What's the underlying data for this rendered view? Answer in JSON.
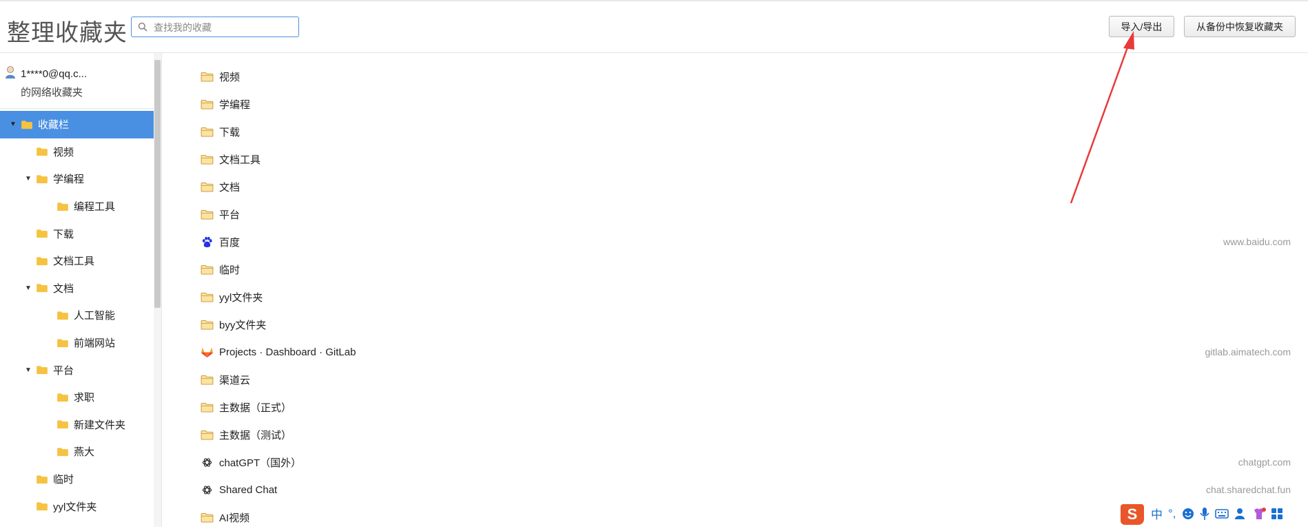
{
  "header": {
    "title": "整理收藏夹",
    "search_placeholder": "查找我的收藏",
    "import_export_label": "导入/导出",
    "restore_label": "从备份中恢复收藏夹"
  },
  "account": {
    "email": "1****0@qq.c...",
    "subtitle": "的网络收藏夹"
  },
  "tree": [
    {
      "label": "收藏栏",
      "level": 0,
      "expanded": true,
      "selected": true
    },
    {
      "label": "视频",
      "level": 1
    },
    {
      "label": "学编程",
      "level": 1,
      "expanded": true
    },
    {
      "label": "编程工具",
      "level": 2
    },
    {
      "label": "下载",
      "level": 1
    },
    {
      "label": "文档工具",
      "level": 1
    },
    {
      "label": "文档",
      "level": 1,
      "expanded": true
    },
    {
      "label": "人工智能",
      "level": 2
    },
    {
      "label": "前端网站",
      "level": 2
    },
    {
      "label": "平台",
      "level": 1,
      "expanded": true
    },
    {
      "label": "求职",
      "level": 2
    },
    {
      "label": "新建文件夹",
      "level": 2
    },
    {
      "label": "燕大",
      "level": 2
    },
    {
      "label": "临时",
      "level": 1
    },
    {
      "label": "yyl文件夹",
      "level": 1
    }
  ],
  "list": [
    {
      "title": "视频",
      "type": "folder",
      "url": ""
    },
    {
      "title": "学编程",
      "type": "folder",
      "url": ""
    },
    {
      "title": "下载",
      "type": "folder",
      "url": ""
    },
    {
      "title": "文档工具",
      "type": "folder",
      "url": ""
    },
    {
      "title": "文档",
      "type": "folder",
      "url": ""
    },
    {
      "title": "平台",
      "type": "folder",
      "url": ""
    },
    {
      "title": "百度",
      "type": "baidu",
      "url": "www.baidu.com"
    },
    {
      "title": "临时",
      "type": "folder",
      "url": ""
    },
    {
      "title": "yyl文件夹",
      "type": "folder",
      "url": ""
    },
    {
      "title": "byy文件夹",
      "type": "folder",
      "url": ""
    },
    {
      "title": "Projects · Dashboard · GitLab",
      "type": "gitlab",
      "url": "gitlab.aimatech.com"
    },
    {
      "title": "渠道云",
      "type": "folder",
      "url": ""
    },
    {
      "title": "主数据（正式）",
      "type": "folder",
      "url": ""
    },
    {
      "title": "主数据（测试）",
      "type": "folder",
      "url": ""
    },
    {
      "title": "chatGPT（国外）",
      "type": "openai",
      "url": "chatgpt.com"
    },
    {
      "title": "Shared Chat",
      "type": "openai",
      "url": "chat.sharedchat.fun"
    },
    {
      "title": "AI视频",
      "type": "folder",
      "url": ""
    }
  ],
  "ime": {
    "mode_label": "中",
    "punct_label": "°,"
  },
  "colors": {
    "accent": "#4a90e2",
    "folder": "#f5c242",
    "annotation_arrow": "#e83a3a"
  }
}
